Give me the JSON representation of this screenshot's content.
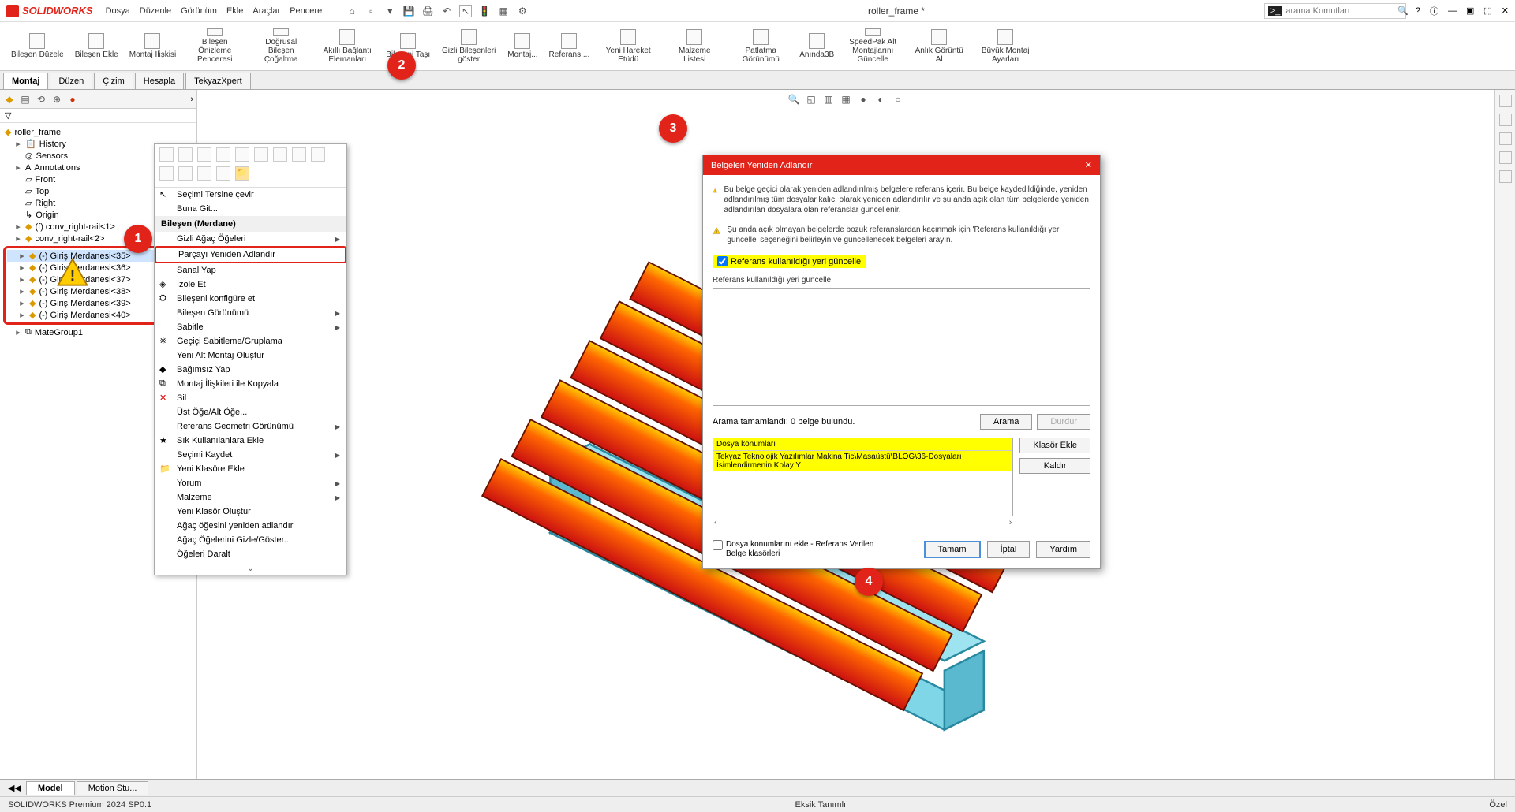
{
  "app": {
    "logo_text": "SOLIDWORKS",
    "doc_title": "roller_frame *",
    "search_placeholder": "arama Komutları"
  },
  "menu": [
    "Dosya",
    "Düzenle",
    "Görünüm",
    "Ekle",
    "Araçlar",
    "Pencere"
  ],
  "ribbon": [
    "Bileşen Düzele",
    "Bileşen Ekle",
    "Montaj İlişkisi",
    "Bileşen Önizleme Penceresi",
    "Doğrusal Bileşen Çoğaltma",
    "Akıllı Bağlantı Elemanları",
    "Bileşeni Taşı",
    "Gizli Bileşenleri göster",
    "Montaj...",
    "Referans ...",
    "Yeni Hareket Etüdü",
    "Malzeme Listesi",
    "Patlatma Görünümü",
    "Anında3B",
    "SpeedPak Alt Montajlarını Güncelle",
    "Anlık Görüntü Al",
    "Büyük Montaj Ayarları"
  ],
  "tabs": [
    {
      "label": "Montaj",
      "active": true
    },
    {
      "label": "Düzen",
      "active": false
    },
    {
      "label": "Çizim",
      "active": false
    },
    {
      "label": "Hesapla",
      "active": false
    },
    {
      "label": "TekyazXpert",
      "active": false
    }
  ],
  "tree": {
    "root": "roller_frame",
    "items": [
      "History",
      "Sensors",
      "Annotations",
      "Front",
      "Top",
      "Right",
      "Origin"
    ],
    "comp1": "(f) conv_right-rail<1>",
    "comp2": "conv_right-rail<2>",
    "rollers": [
      "(-) Giriş Merdanesi<35>",
      "(-) Giriş Merdanesi<36>",
      "(-) Giriş Merdanesi<37>",
      "(-) Giriş Merdanesi<38>",
      "(-) Giriş Merdanesi<39>",
      "(-) Giriş Merdanesi<40>"
    ],
    "mates": "MateGroup1"
  },
  "context": {
    "header": "Bileşen (Merdane)",
    "items_top": [
      "Seçimi Tersine çevir",
      "Buna Git..."
    ],
    "items_mid": [
      "Gizli Ağaç Öğeleri",
      "Parçayı Yeniden Adlandır",
      "Sanal Yap",
      "İzole Et",
      "Bileşeni konfigüre et",
      "Bileşen Görünümü",
      "Sabitle",
      "Geçiçi Sabitleme/Gruplama",
      "Yeni Alt Montaj Oluştur",
      "Bağımsız Yap",
      "Montaj İlişkileri ile Kopyala",
      "Sil",
      "Üst Öğe/Alt Öğe...",
      "Referans Geometri Görünümü",
      "Sık Kullanılanlara Ekle",
      "Seçimi Kaydet",
      "Yeni Klasöre Ekle",
      "Yorum",
      "Malzeme",
      "Yeni Klasör Oluştur",
      "Ağaç öğesini yeniden adlandır",
      "Ağaç Öğelerini Gizle/Göster...",
      "Öğeleri Daralt"
    ]
  },
  "dialog": {
    "title": "Belgeleri Yeniden Adlandır",
    "warn1": "Bu belge geçici olarak yeniden adlandırılmış belgelere referans içerir. Bu belge kaydedildiğinde, yeniden adlandırılmış tüm dosyalar kalıcı olarak yeniden adlandırılır ve şu anda açık olan tüm belgelerde yeniden adlandırılan dosyalara olan referanslar güncellenir.",
    "warn2": "Şu anda açık olmayan belgelerde bozuk referanslardan kaçınmak için 'Referans kullanıldığı yeri güncelle' seçeneğini belirleyin ve güncellenecek belgeleri arayın.",
    "checkbox": "Referans kullanıldığı yeri güncelle",
    "list_label": "Referans kullanıldığı yeri güncelle",
    "search_status": "Arama tamamlandı: 0 belge bulundu.",
    "search_btn": "Arama",
    "stop_btn": "Durdur",
    "file_loc_header": "Dosya konumları",
    "file_loc_item": "Tekyaz Teknolojik Yazılımlar Makina Tic\\Masaüstü\\BLOG\\36-Dosyaları İsimlendirmenin Kolay Y",
    "add_folder": "Klasör Ekle",
    "remove": "Kaldır",
    "footer_check": "Dosya konumlarını ekle - Referans Verilen Belge klasörleri",
    "ok": "Tamam",
    "cancel": "İptal",
    "help": "Yardım"
  },
  "bottom_tabs": [
    {
      "label": "Model",
      "active": true
    },
    {
      "label": "Motion Stu...",
      "active": false
    }
  ],
  "status": {
    "left": "SOLIDWORKS Premium 2024 SP0.1",
    "mid": "Eksik Tanımlı",
    "right": "Özel"
  },
  "badges": [
    "1",
    "2",
    "3",
    "4"
  ]
}
